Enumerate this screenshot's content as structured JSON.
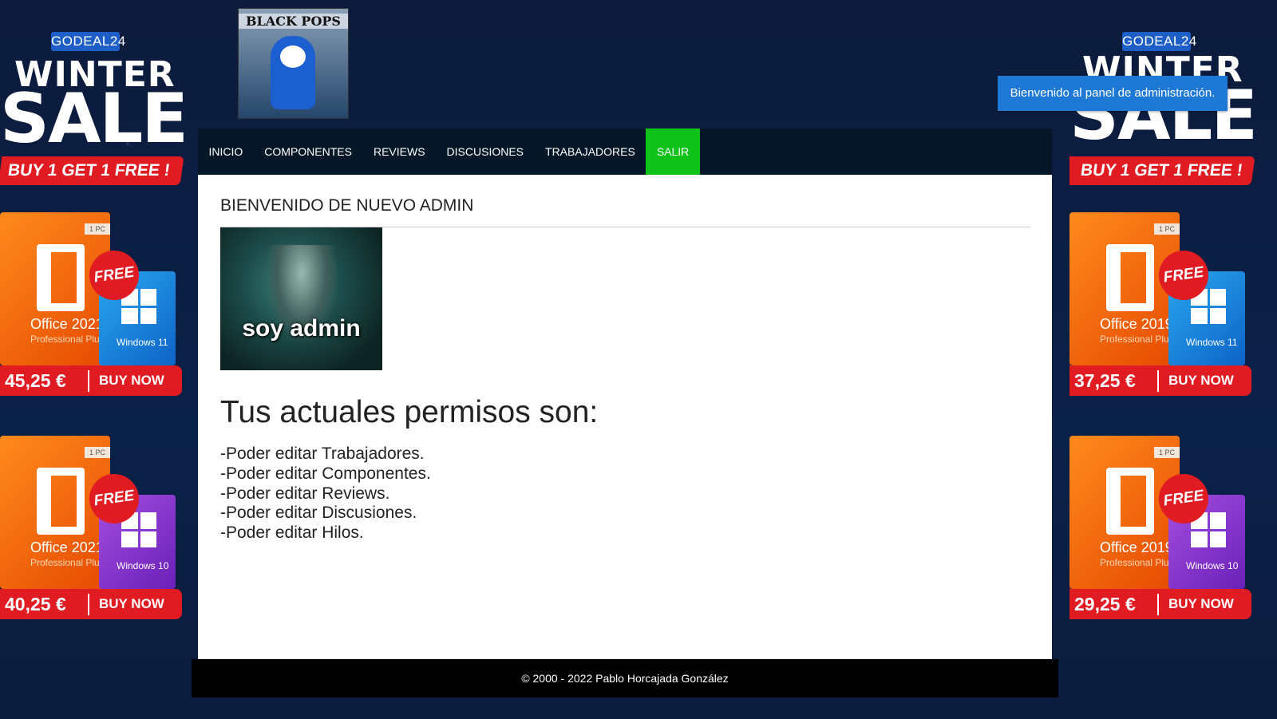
{
  "ads": {
    "left": {
      "brand": "GODEAL24",
      "headline1": "WINTER",
      "headline2": "SALE",
      "promo": "BUY 1 GET 1 FREE !",
      "products": [
        {
          "office": "Office 2021",
          "office_sub": "Professional Plus",
          "windows": "Windows 11",
          "price": "45,25 €",
          "cta": "BUY NOW",
          "free": "FREE",
          "pc": "1 PC",
          "win_color": "blue"
        },
        {
          "office": "Office 2021",
          "office_sub": "Professional Plus",
          "windows": "Windows 10",
          "price": "40,25 €",
          "cta": "BUY NOW",
          "free": "FREE",
          "pc": "1 PC",
          "win_color": "purple"
        }
      ]
    },
    "right": {
      "brand": "GODEAL24",
      "headline1": "WINTER",
      "headline2": "SALE",
      "promo": "BUY 1 GET 1 FREE !",
      "products": [
        {
          "office": "Office 2019",
          "office_sub": "Professional Plus",
          "windows": "Windows 11",
          "price": "37,25 €",
          "cta": "BUY NOW",
          "free": "FREE",
          "pc": "1 PC",
          "win_color": "blue"
        },
        {
          "office": "Office 2019",
          "office_sub": "Professional Plus",
          "windows": "Windows 10",
          "price": "29,25 €",
          "cta": "BUY NOW",
          "free": "FREE",
          "pc": "1 PC",
          "win_color": "purple"
        }
      ]
    }
  },
  "header": {
    "logo_text": "BLACK POPS"
  },
  "toast": {
    "message": "Bienvenido al panel de administración."
  },
  "nav": {
    "items": [
      {
        "label": "INICIO",
        "active": false
      },
      {
        "label": "COMPONENTES",
        "active": false
      },
      {
        "label": "REVIEWS",
        "active": false
      },
      {
        "label": "DISCUSIONES",
        "active": false
      },
      {
        "label": "TRABAJADORES",
        "active": false
      },
      {
        "label": "SALIR",
        "active": true
      }
    ],
    "active_color": "#0ec219"
  },
  "main": {
    "welcome": "BIENVENIDO DE NUEVO ADMIN",
    "image_caption": "soy admin",
    "permissions_title": "Tus actuales permisos son:",
    "permissions": [
      "-Poder editar Trabajadores.",
      "-Poder editar Componentes.",
      "-Poder editar Reviews.",
      "-Poder editar Discusiones.",
      "-Poder editar Hilos."
    ]
  },
  "footer": {
    "text": "© 2000 - 2022 Pablo Horcajada González"
  }
}
